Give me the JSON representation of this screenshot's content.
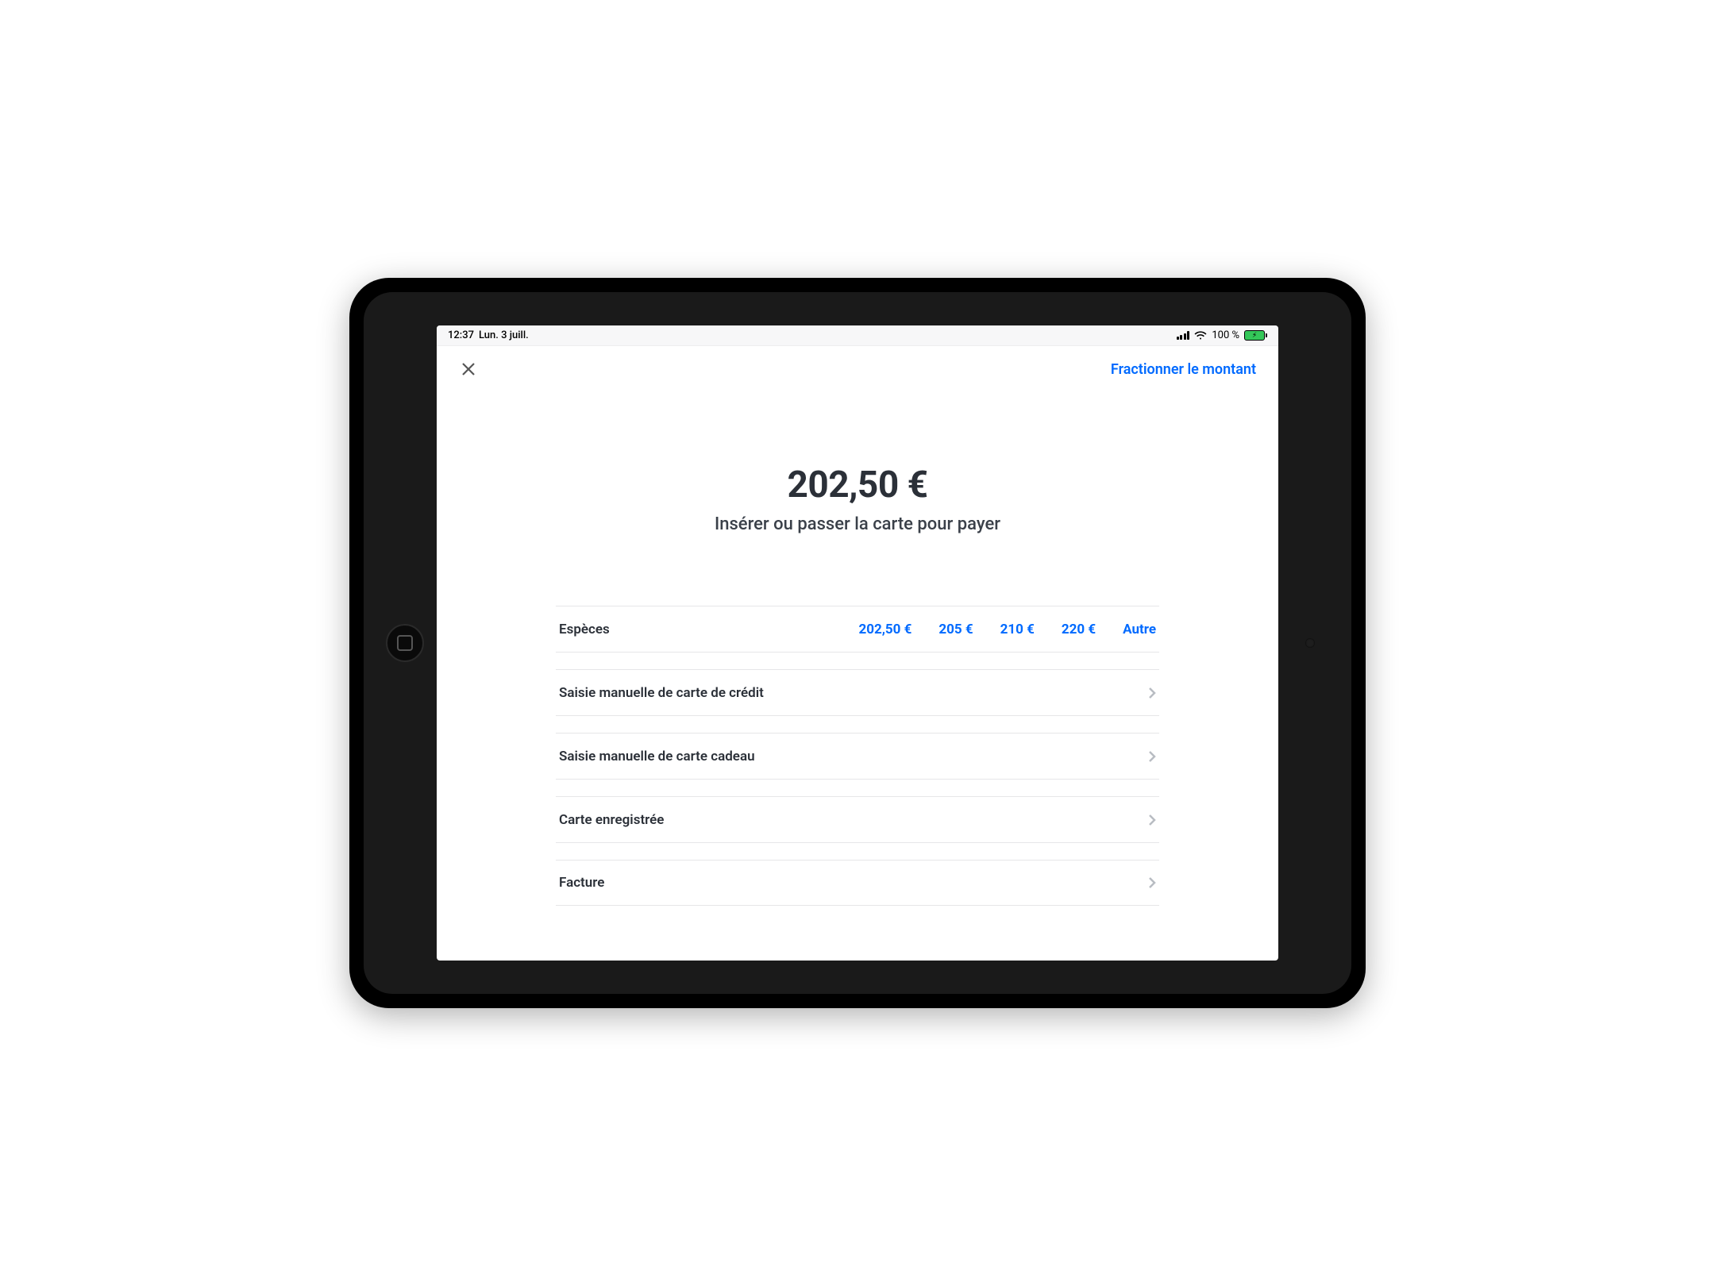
{
  "status_bar": {
    "time": "12:37",
    "date": "Lun. 3 juill.",
    "battery_percent": "100 %"
  },
  "header": {
    "split_action": "Fractionner le montant"
  },
  "payment": {
    "amount": "202,50 €",
    "instruction": "Insérer ou passer la carte pour payer"
  },
  "cash_row": {
    "label": "Espèces",
    "amounts": [
      "202,50 €",
      "205 €",
      "210 €",
      "220 €",
      "Autre"
    ]
  },
  "options": [
    {
      "label": "Saisie manuelle de carte de crédit"
    },
    {
      "label": "Saisie manuelle de carte cadeau"
    },
    {
      "label": "Carte enregistrée"
    },
    {
      "label": "Facture"
    }
  ],
  "colors": {
    "accent": "#006aff"
  }
}
